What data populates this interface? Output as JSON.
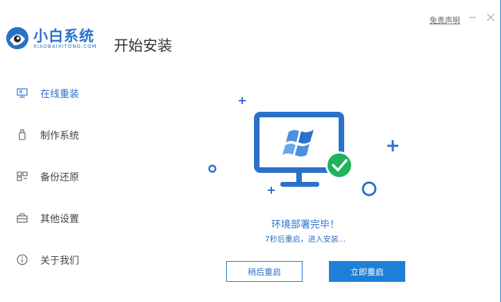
{
  "header": {
    "brand_cn": "小白系统",
    "brand_en": "XIAOBAIXITONG.COM",
    "title": "开始安装",
    "disclaimer": "免责声明",
    "minimize_icon": "minimize-icon",
    "close_icon": "close-icon"
  },
  "sidebar": {
    "items": [
      {
        "label": "在线重装",
        "icon": "monitor-icon",
        "active": true
      },
      {
        "label": "制作系统",
        "icon": "usb-icon",
        "active": false
      },
      {
        "label": "备份还原",
        "icon": "backup-icon",
        "active": false
      },
      {
        "label": "其他设置",
        "icon": "settings-box-icon",
        "active": false
      },
      {
        "label": "关于我们",
        "icon": "info-icon",
        "active": false
      }
    ]
  },
  "main": {
    "status_title": "环境部署完毕！",
    "status_sub": "7秒后重启，进入安装...",
    "later_button": "稍后重启",
    "now_button": "立即重启"
  },
  "colors": {
    "accent": "#2a71c9",
    "button_primary": "#1e7fd8",
    "success": "#1fb35a"
  }
}
